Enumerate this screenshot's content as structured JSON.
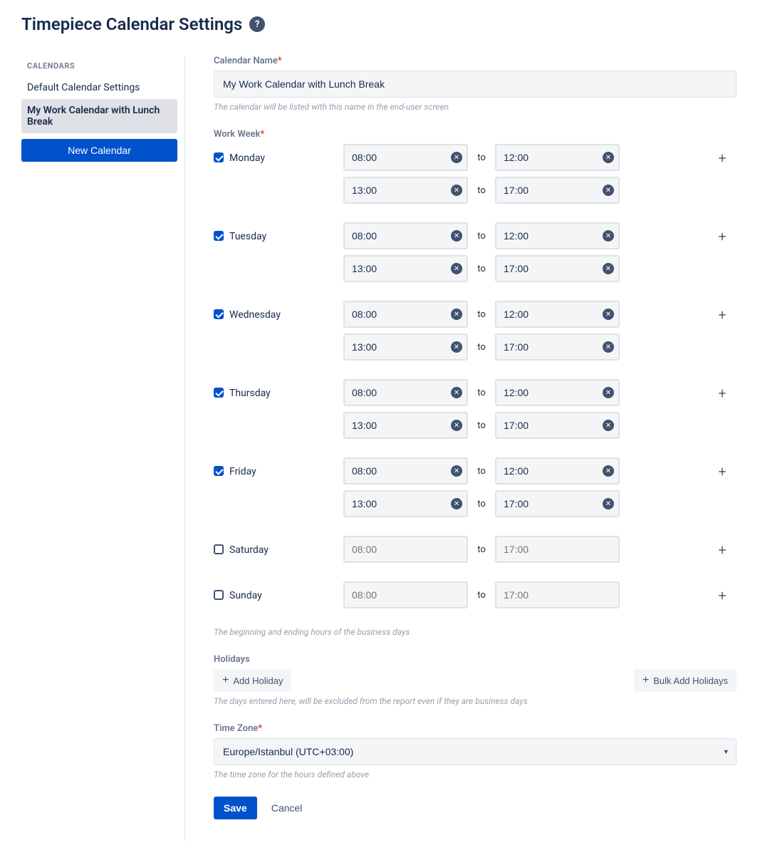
{
  "header": {
    "title": "Timepiece Calendar Settings"
  },
  "sidebar": {
    "heading": "CALENDARS",
    "items": [
      {
        "label": "Default Calendar Settings",
        "active": false
      },
      {
        "label": "My Work Calendar with Lunch Break",
        "active": true
      }
    ],
    "new_button": "New Calendar"
  },
  "form": {
    "name_label": "Calendar Name",
    "name_value": "My Work Calendar with Lunch Break",
    "name_hint": "The calendar will be listed with this name in the end-user screen",
    "workweek_label": "Work Week",
    "to_label": "to",
    "days": [
      {
        "name": "Monday",
        "checked": true,
        "slots": [
          {
            "start": "08:00",
            "end": "12:00"
          },
          {
            "start": "13:00",
            "end": "17:00"
          }
        ]
      },
      {
        "name": "Tuesday",
        "checked": true,
        "slots": [
          {
            "start": "08:00",
            "end": "12:00"
          },
          {
            "start": "13:00",
            "end": "17:00"
          }
        ]
      },
      {
        "name": "Wednesday",
        "checked": true,
        "slots": [
          {
            "start": "08:00",
            "end": "12:00"
          },
          {
            "start": "13:00",
            "end": "17:00"
          }
        ]
      },
      {
        "name": "Thursday",
        "checked": true,
        "slots": [
          {
            "start": "08:00",
            "end": "12:00"
          },
          {
            "start": "13:00",
            "end": "17:00"
          }
        ]
      },
      {
        "name": "Friday",
        "checked": true,
        "slots": [
          {
            "start": "08:00",
            "end": "12:00"
          },
          {
            "start": "13:00",
            "end": "17:00"
          }
        ]
      },
      {
        "name": "Saturday",
        "checked": false,
        "slots": [
          {
            "start": "08:00",
            "end": "17:00"
          }
        ]
      },
      {
        "name": "Sunday",
        "checked": false,
        "slots": [
          {
            "start": "08:00",
            "end": "17:00"
          }
        ]
      }
    ],
    "workweek_hint": "The beginning and ending hours of the business days",
    "holidays_label": "Holidays",
    "add_holiday": "Add Holiday",
    "bulk_add": "Bulk Add Holidays",
    "holidays_hint": "The days entered here, will be excluded from the report even if they are business days",
    "tz_label": "Time Zone",
    "tz_value": "Europe/Istanbul (UTC+03:00)",
    "tz_hint": "The time zone for the hours defined above",
    "save": "Save",
    "cancel": "Cancel"
  }
}
